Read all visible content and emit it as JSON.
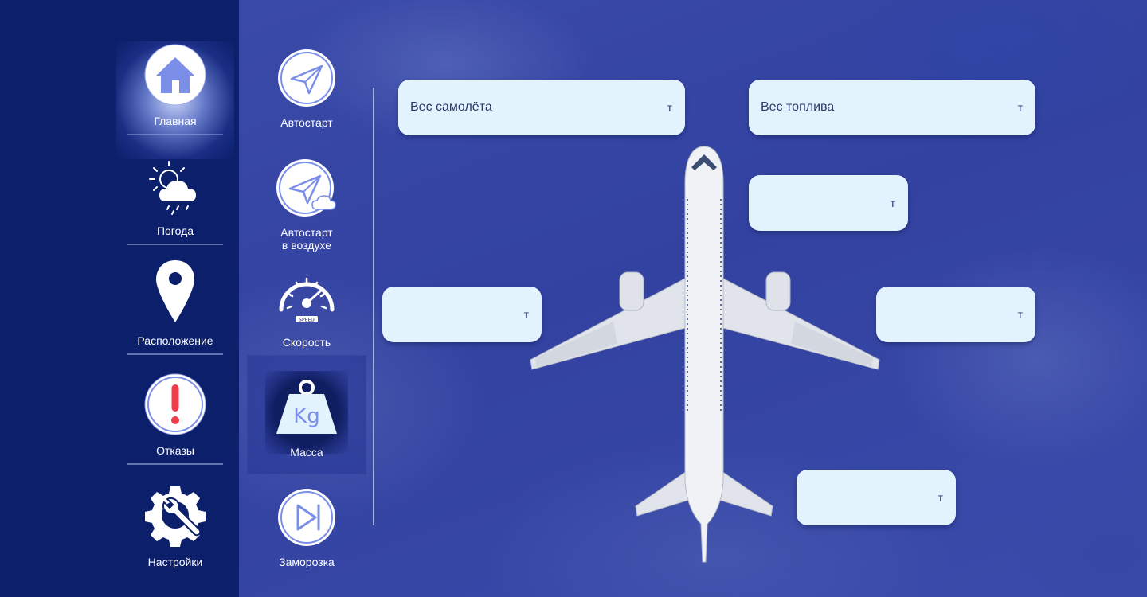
{
  "sidebar": {
    "items": [
      {
        "label": "Главная",
        "icon": "home-icon",
        "active": true
      },
      {
        "label": "Погода",
        "icon": "weather-icon"
      },
      {
        "label": "Расположение",
        "icon": "location-pin-icon"
      },
      {
        "label": "Отказы",
        "icon": "failure-alert-icon"
      },
      {
        "label": "Настройки",
        "icon": "settings-wrench-gear-icon"
      }
    ]
  },
  "subpanel": {
    "items": [
      {
        "label": "Автостарт",
        "icon": "paper-plane-icon"
      },
      {
        "label_line1": "Автостарт",
        "label_line2": "в воздухе",
        "icon": "paper-plane-cloud-icon"
      },
      {
        "label": "Скорость",
        "icon": "speedometer-icon",
        "gauge_text": "SPEED"
      },
      {
        "label": "Масса",
        "icon": "weight-kg-icon",
        "weight_text": "Kg",
        "active": true
      },
      {
        "label": "Заморозка",
        "icon": "freeze-play-pause-icon"
      }
    ]
  },
  "fields": {
    "aircraft_weight": {
      "label": "Вес самолёта",
      "unit": "т"
    },
    "fuel_weight": {
      "label": "Вес топлива",
      "unit": "т"
    },
    "field_3": {
      "label": "",
      "unit": "т"
    },
    "field_4": {
      "label": "",
      "unit": "т"
    },
    "field_5": {
      "label": "",
      "unit": "т"
    },
    "field_6": {
      "label": "",
      "unit": "т"
    }
  },
  "colors": {
    "sidebar_bg": "#0b1f6b",
    "main_bg": "#3342a0",
    "field_bg": "#e3f3fd",
    "icon_accent": "#7b8fe8",
    "alert_red": "#ee3d4a"
  }
}
